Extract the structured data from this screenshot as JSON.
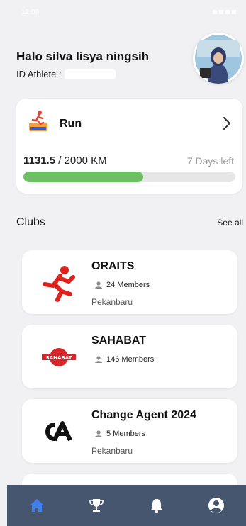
{
  "status_bar": {
    "time": "12.09"
  },
  "header": {
    "greeting": "Halo silva lisya ningsih",
    "athlete_label": "ID Athlete :"
  },
  "event": {
    "title": "Run",
    "progress_current": "1131.5",
    "progress_total": "/ 2000 KM",
    "progress_fraction": 0.566,
    "days_left": "7 Days left"
  },
  "clubs": {
    "title": "Clubs",
    "see_all": "See all",
    "items": [
      {
        "name": "ORAITS",
        "members": "24 Members",
        "city": "Pekanbaru"
      },
      {
        "name": "SAHABAT",
        "members": "146 Members",
        "city": ""
      },
      {
        "name": "Change Agent 2024",
        "members": "5 Members",
        "city": "Pekanbaru"
      }
    ]
  },
  "colors": {
    "progress_fill": "#6cbf63",
    "nav_bg": "#46566f",
    "nav_active": "#3f7ff0"
  },
  "nav": [
    "home-icon",
    "trophy-icon",
    "bell-icon",
    "profile-icon"
  ]
}
